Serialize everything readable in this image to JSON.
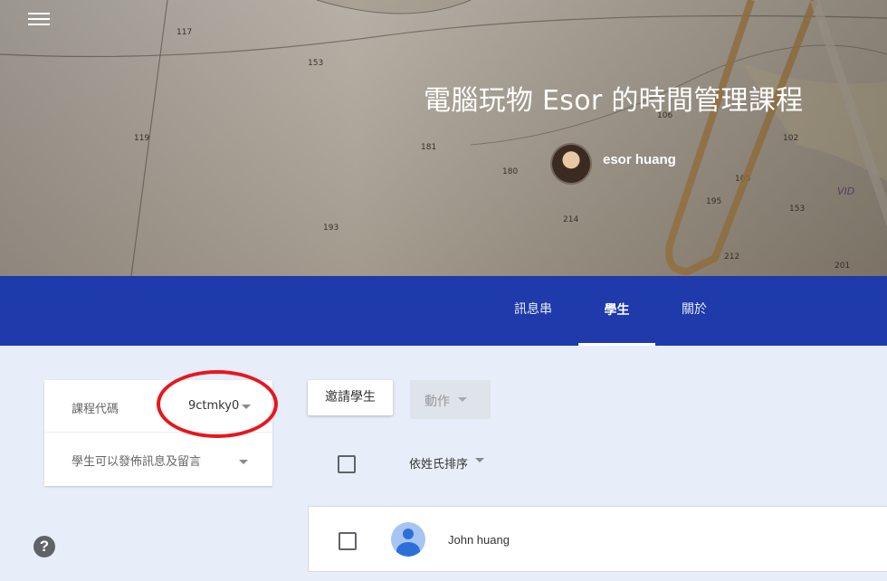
{
  "header": {
    "menu_icon": "hamburger-menu-icon",
    "course_title": "電腦玩物 Esor 的時間管理課程",
    "teacher_name": "esor huang"
  },
  "nav": {
    "tabs": [
      {
        "label": "訊息串",
        "active": false
      },
      {
        "label": "學生",
        "active": true
      },
      {
        "label": "關於",
        "active": false
      }
    ],
    "color": "#1e3aab"
  },
  "settings": {
    "course_code_label": "課程代碼",
    "course_code": "9ctmky0",
    "post_permission_label": "學生可以發佈訊息及留言"
  },
  "toolbar": {
    "invite_label": "邀請學生",
    "actions_label": "動作",
    "sort_label": "依姓氏排序"
  },
  "students": [
    {
      "name": "John huang"
    }
  ],
  "help_icon": "?",
  "annotation_color": "#e8161e"
}
